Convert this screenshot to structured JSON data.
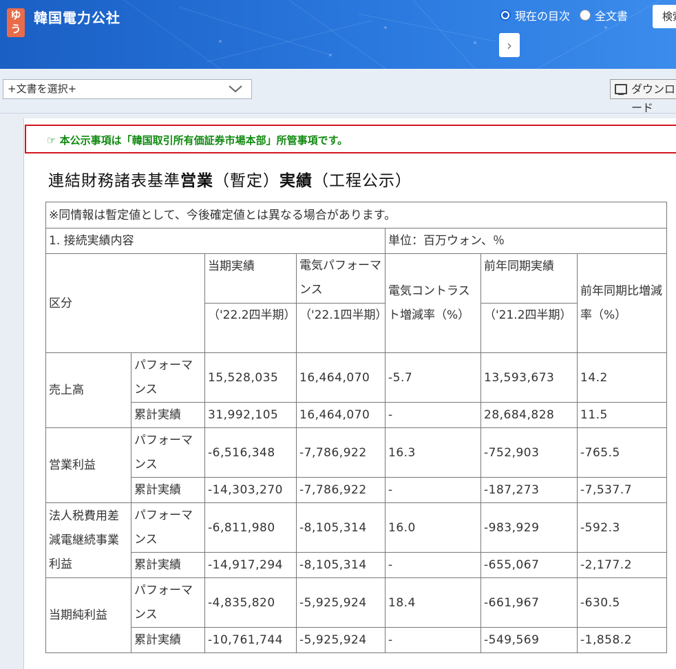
{
  "header": {
    "logo_text": "ゆう",
    "company": "韓国電力公社",
    "radio_current": "現在の目次",
    "radio_full": "全文書",
    "search_label": "検索",
    "next_symbol": "›"
  },
  "toolbar": {
    "doc_select": "+文書を選択+",
    "download": "ダウンロード"
  },
  "notice": "☞ 本公示事項は「韓国取引所有価証券市場本部」所管事項です。",
  "title": {
    "p1": "連結財務諸表基準",
    "p2": "営業",
    "p3": "（暫定）",
    "p4": "実績",
    "p5": "（工程公示）"
  },
  "table": {
    "note": "※同情報は暫定値として、今後確定値とは異なる場合があります。",
    "section": "1. 接続実績内容",
    "unit": "単位：百万ウォン、％",
    "headers": {
      "category": "区分",
      "current": "当期実績",
      "current_period": "（'22.2四半期）",
      "prev_quarter": "電気パフォーマンス",
      "prev_quarter_period": "（'22.1四半期）",
      "qoq": "電気コントラスト増減率（%）",
      "yoy_actual": "前年同期実績",
      "yoy_period": "（'21.2四半期）",
      "yoy_rate": "前年同期比増減率（%）"
    },
    "sub_perf": "パフォーマンス",
    "sub_cum": "累計実績",
    "rows": [
      {
        "label": "売上高",
        "perf": [
          "15,528,035",
          "16,464,070",
          "-5.7",
          "13,593,673",
          "14.2"
        ],
        "cum": [
          "31,992,105",
          "16,464,070",
          "-",
          "28,684,828",
          "11.5"
        ]
      },
      {
        "label": "営業利益",
        "perf": [
          "-6,516,348",
          "-7,786,922",
          "16.3",
          "-752,903",
          "-765.5"
        ],
        "cum": [
          "-14,303,270",
          "-7,786,922",
          "-",
          "-187,273",
          "-7,537.7"
        ]
      },
      {
        "label": "法人税費用差減電継続事業利益",
        "perf": [
          "-6,811,980",
          "-8,105,314",
          "16.0",
          "-983,929",
          "-592.3"
        ],
        "cum": [
          "-14,917,294",
          "-8,105,314",
          "-",
          "-655,067",
          "-2,177.2"
        ]
      },
      {
        "label": "当期純利益",
        "perf": [
          "-4,835,820",
          "-5,925,924",
          "18.4",
          "-661,967",
          "-630.5"
        ],
        "cum": [
          "-10,761,744",
          "-5,925,924",
          "-",
          "-549,569",
          "-1,858.2"
        ]
      }
    ]
  }
}
